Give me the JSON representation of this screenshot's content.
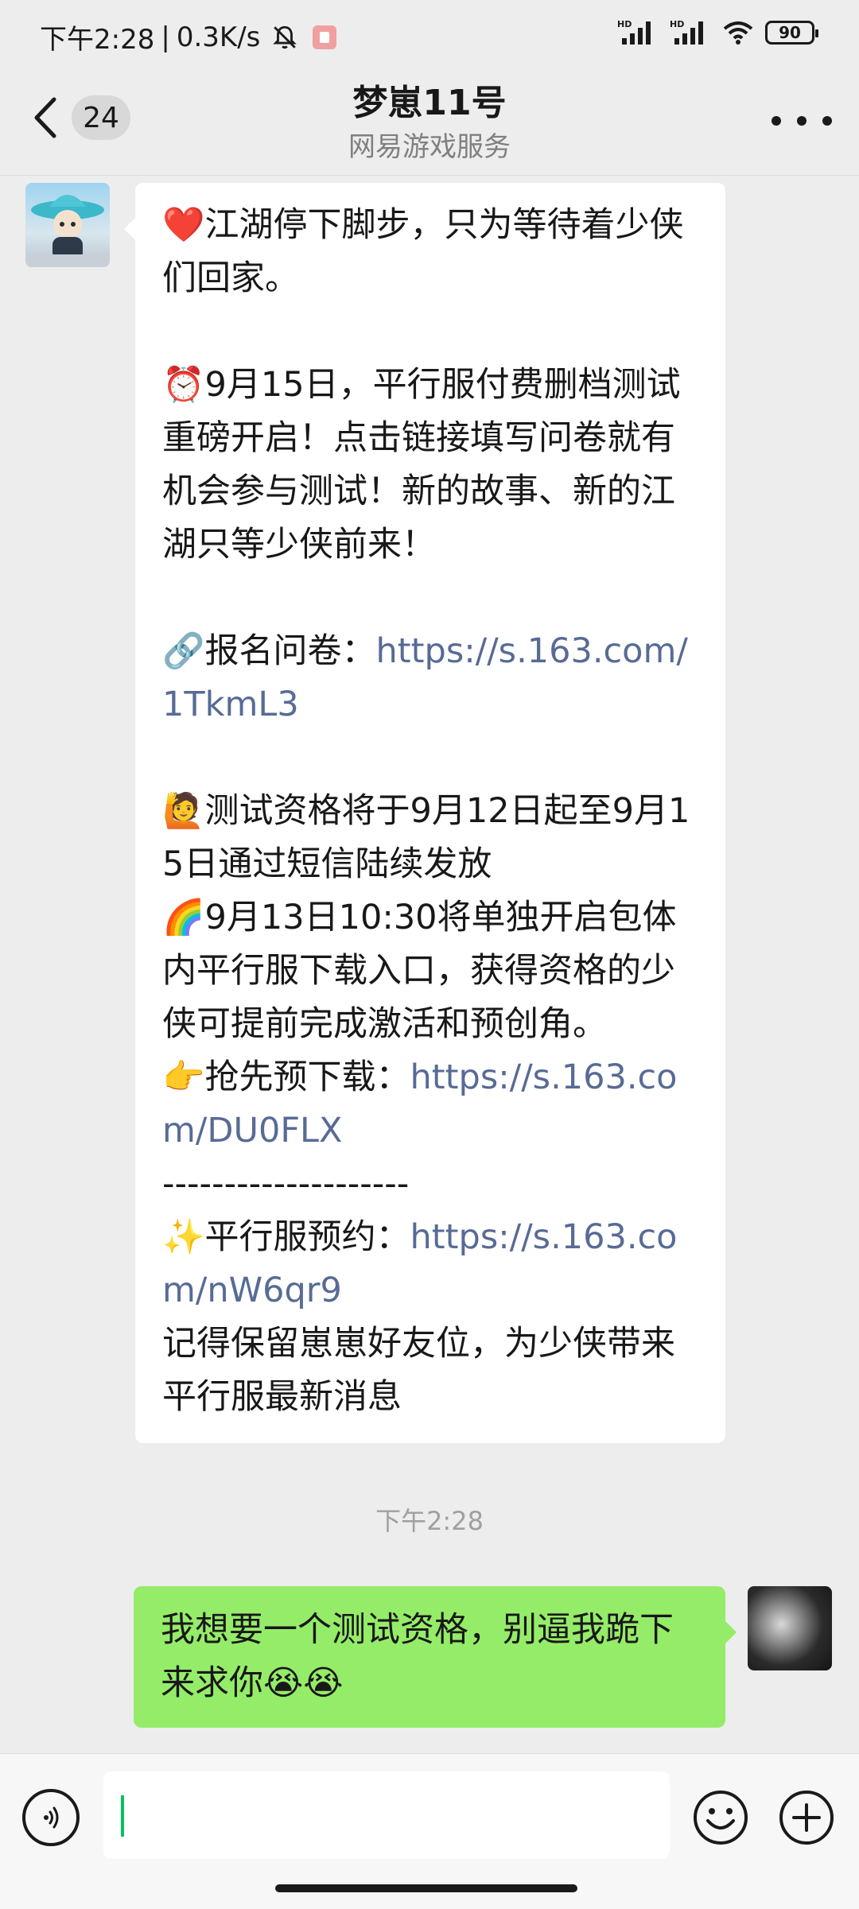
{
  "status_bar": {
    "time": "下午2:28",
    "separator": "|",
    "speed": "0.3K/s",
    "battery": "90",
    "signal_label_1": "HD",
    "signal_label_2": "HD"
  },
  "header": {
    "unread_count": "24",
    "title": "梦崽11号",
    "subtitle": "网易游戏服务"
  },
  "messages": {
    "incoming": {
      "p1": "❤️江湖停下脚步，只为等待着少侠们回家。",
      "p2": "⏰9月15日，平行服付费删档测试重磅开启！点击链接填写问卷就有机会参与测试！新的故事、新的江湖只等少侠前来！",
      "p3_label": "🔗报名问卷：",
      "p3_link": "https://s.163.com/1TkmL3",
      "p4": "🙋测试资格将于9月12日起至9月15日通过短信陆续发放",
      "p5": "🌈9月13日10:30将单独开启包体内平行服下载入口，获得资格的少侠可提前完成激活和预创角。",
      "p6_label": "👉抢先预下载：",
      "p6_link": "https://s.163.com/DU0FLX",
      "divider": "--------------------",
      "p7_label": "✨平行服预约：",
      "p7_link": "https://s.163.com/nW6qr9",
      "p8": "记得保留崽崽好友位，为少侠带来平行服最新消息"
    },
    "timestamp": "下午2:28",
    "outgoing": {
      "text": "我想要一个测试资格，别逼我跪下来求你😭😭"
    }
  },
  "input_bar": {
    "value": ""
  },
  "colors": {
    "background": "#ededed",
    "incoming_bubble": "#ffffff",
    "outgoing_bubble": "#95ec69",
    "link": "#576b95",
    "caret": "#07c160"
  }
}
